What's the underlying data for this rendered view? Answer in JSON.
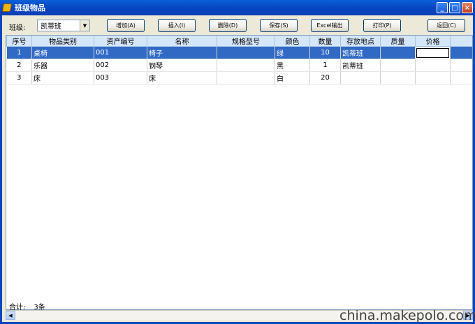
{
  "window": {
    "title": "班级物品",
    "minimize": "_",
    "maximize": "□",
    "close": "×"
  },
  "toolbar": {
    "class_label": "班级:",
    "class_value": "凯蒂班",
    "buttons": [
      "增加(A)",
      "插入(I)",
      "删除(D)",
      "保存(S)",
      "Excel输出",
      "打印(P)",
      "返回(C)"
    ]
  },
  "grid": {
    "columns": [
      "序号",
      "物品类别",
      "资产编号",
      "名称",
      "规格型号",
      "颜色",
      "数量",
      "存放地点",
      "质量",
      "价格",
      ""
    ],
    "rows": [
      [
        "1",
        "桌椅",
        "001",
        "椅子",
        "",
        "绿",
        "10",
        "凯蒂班",
        "",
        "",
        ""
      ],
      [
        "2",
        "乐器",
        "002",
        "钢琴",
        "",
        "黑",
        "1",
        "凯蒂班",
        "",
        "",
        ""
      ],
      [
        "3",
        "床",
        "003",
        "床",
        "",
        "白",
        "20",
        "",
        "",
        "",
        ""
      ]
    ],
    "selected_row": 0
  },
  "footer": {
    "total_label": "合计:",
    "total_value": "3条"
  },
  "watermark": "china.makepolo.com",
  "colors": {
    "titlebar": "#0846c2",
    "selection": "#316ac5",
    "header": "#d4e6fb"
  }
}
